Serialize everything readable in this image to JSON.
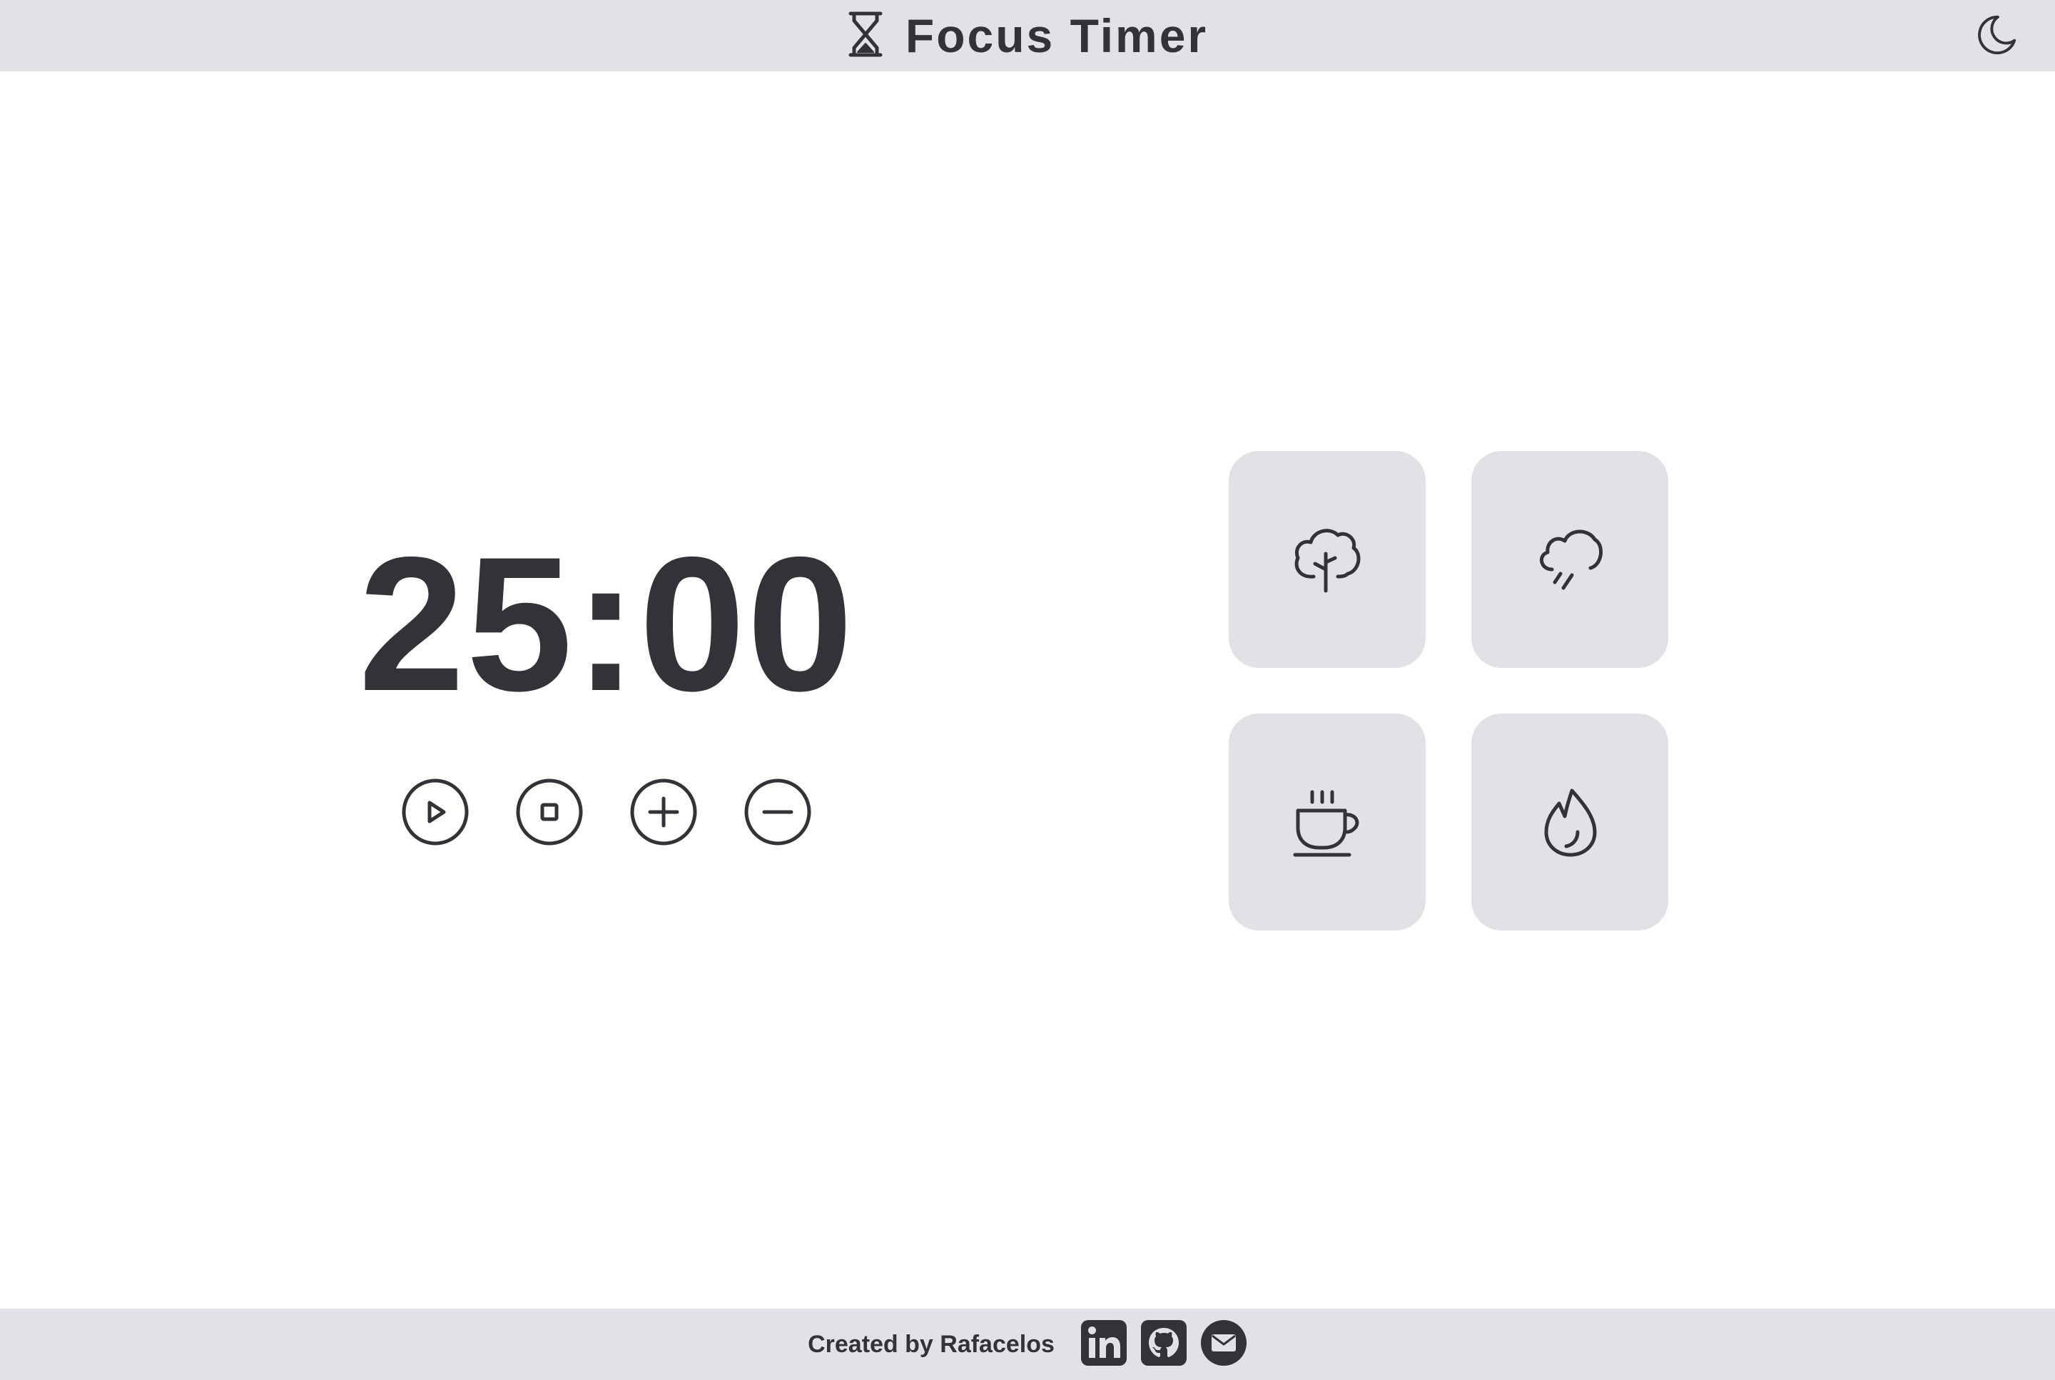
{
  "header": {
    "title": "Focus Timer",
    "logo_icon": "hourglass-icon",
    "theme_toggle_icon": "moon-icon"
  },
  "timer": {
    "display": "25:00",
    "controls": [
      {
        "name": "play-button",
        "icon": "play-circle-icon"
      },
      {
        "name": "stop-button",
        "icon": "stop-circle-icon"
      },
      {
        "name": "increase-button",
        "icon": "plus-circle-icon"
      },
      {
        "name": "decrease-button",
        "icon": "minus-circle-icon"
      }
    ]
  },
  "sounds": [
    {
      "name": "forest-sound",
      "icon": "tree-icon"
    },
    {
      "name": "rain-sound",
      "icon": "cloud-rain-icon"
    },
    {
      "name": "coffee-shop-sound",
      "icon": "coffee-icon"
    },
    {
      "name": "fireplace-sound",
      "icon": "flame-icon"
    }
  ],
  "footer": {
    "credit": "Created by Rafacelos",
    "links": [
      {
        "name": "linkedin-link",
        "icon": "linkedin-icon"
      },
      {
        "name": "github-link",
        "icon": "github-icon"
      },
      {
        "name": "email-link",
        "icon": "mail-icon"
      }
    ]
  },
  "colors": {
    "bar_background": "#e1e1e6",
    "card_background": "#e1e1e6",
    "text": "#323238",
    "page_background": "#ffffff"
  }
}
